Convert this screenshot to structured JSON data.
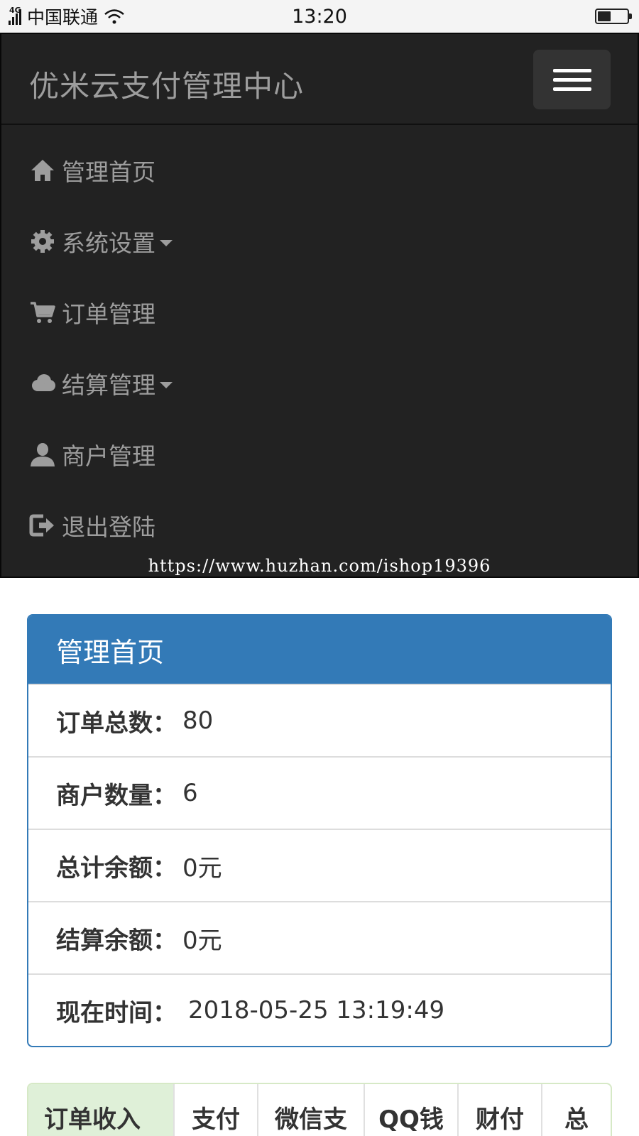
{
  "status_bar": {
    "network": "4G",
    "carrier": "中国联通",
    "time": "13:20",
    "battery_level": 0.45
  },
  "navbar": {
    "brand": "优米云支付管理中心",
    "menu": [
      {
        "label": "管理首页",
        "icon": "home-icon",
        "dropdown": false
      },
      {
        "label": "系统设置",
        "icon": "gear-icon",
        "dropdown": true
      },
      {
        "label": "订单管理",
        "icon": "cart-icon",
        "dropdown": false
      },
      {
        "label": "结算管理",
        "icon": "cloud-icon",
        "dropdown": true
      },
      {
        "label": "商户管理",
        "icon": "user-icon",
        "dropdown": false
      },
      {
        "label": "退出登陆",
        "icon": "logout-icon",
        "dropdown": false
      }
    ],
    "watermark": "https://www.huzhan.com/ishop19396"
  },
  "panel": {
    "title": "管理首页",
    "rows": [
      {
        "label": "订单总数：",
        "value": "80"
      },
      {
        "label": "商户数量：",
        "value": "6"
      },
      {
        "label": "总计余额：",
        "value": "0元"
      },
      {
        "label": "结算余额：",
        "value": "0元"
      },
      {
        "label": "现在时间：",
        "value": "2018-05-25 13:19:49"
      }
    ]
  },
  "table": {
    "headers": [
      "订单收入",
      "支付",
      "微信支",
      "QQ钱",
      "财付",
      "总"
    ]
  },
  "colors": {
    "navbar_bg": "#222222",
    "nav_text": "#9d9d9d",
    "panel_primary": "#337ab7",
    "table_success": "#dff0d8"
  }
}
